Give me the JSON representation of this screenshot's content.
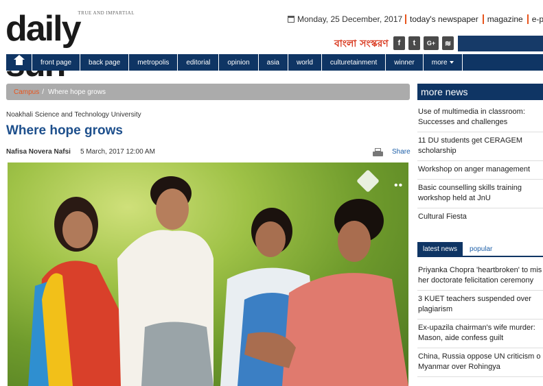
{
  "header": {
    "logo_tagline": "TRUE AND IMPARTIAL",
    "logo_name": "daily sun",
    "date": "Monday, 25 December, 2017",
    "top_links": [
      "today's newspaper",
      "magazine",
      "e-pap"
    ],
    "bangla_label": "বাংলা সংস্করণ",
    "social": [
      "f",
      "t",
      "G+",
      "rss"
    ]
  },
  "nav": {
    "items": [
      "front page",
      "back page",
      "metropolis",
      "editorial",
      "opinion",
      "asia",
      "world",
      "culturetainment",
      "winner",
      "more"
    ]
  },
  "breadcrumb": {
    "section": "Campus",
    "separator": "/",
    "current": "Where hope grows"
  },
  "article": {
    "kicker": "Noakhali Science and Technology University",
    "title": "Where hope grows",
    "author": "Nafisa Novera Nafsi",
    "date": "5 March, 2017 12:00 AM",
    "share_label": "Share"
  },
  "sidebar": {
    "more_news_title": "more news",
    "more_news": [
      "Use of multimedia in classroom: Successes and challenges",
      "11 DU students get CERAGEM scholarship",
      "Workshop on anger management",
      "Basic counselling skills training workshop held at JnU",
      "Cultural Fiesta"
    ],
    "tabs": [
      "latest news",
      "popular"
    ],
    "latest": [
      [
        "Priyanka Chopra 'heartbroken' to mis",
        "her doctorate felicitation ceremony"
      ],
      [
        "3 KUET teachers suspended over",
        "plagiarism"
      ],
      [
        "Ex-upazila chairman's wife murder:",
        "Mason, aide confess guilt"
      ],
      [
        "China, Russia oppose UN criticism o",
        "Myanmar over Rohingya"
      ]
    ]
  },
  "colors": {
    "brand_navy": "#0f3564",
    "accent_orange": "#e8541c",
    "headline_blue": "#1d4f8c"
  }
}
